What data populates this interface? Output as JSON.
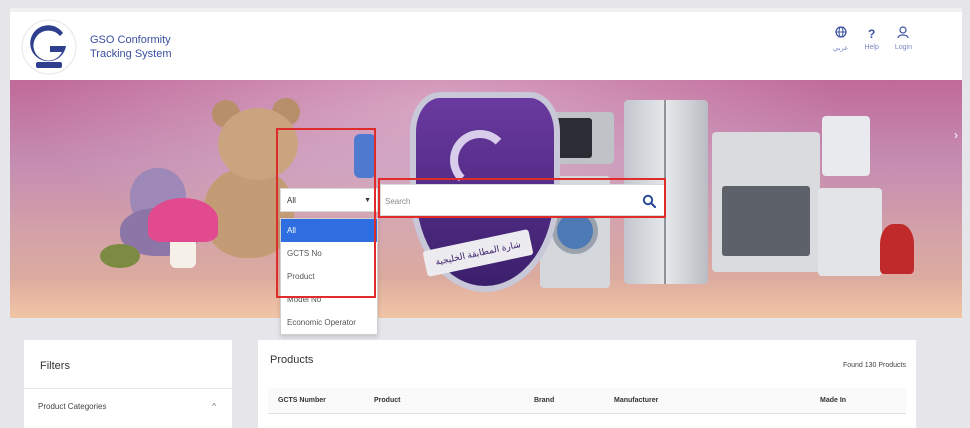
{
  "header": {
    "brand_line1": "GSO Conformity",
    "brand_line2": "Tracking System",
    "links": [
      {
        "label": "عربي",
        "icon": "globe-icon"
      },
      {
        "label": "Help",
        "icon": "help-icon"
      },
      {
        "label": "Login",
        "icon": "user-icon"
      }
    ]
  },
  "banner": {
    "ribbon_text": "شارة المطابقة الخليجية"
  },
  "search": {
    "category_selected": "All",
    "placeholder": "Search",
    "dropdown_options": [
      "All",
      "GCTS No",
      "Product",
      "Model No",
      "Economic Operator"
    ],
    "highlight_color": "#e02b2b"
  },
  "filters": {
    "title": "Filters",
    "category_label": "Product Categories"
  },
  "products": {
    "title": "Products",
    "found_text": "Found 130 Products",
    "columns": [
      "GCTS Number",
      "Product",
      "Brand",
      "Manufacturer",
      "Made In"
    ]
  }
}
